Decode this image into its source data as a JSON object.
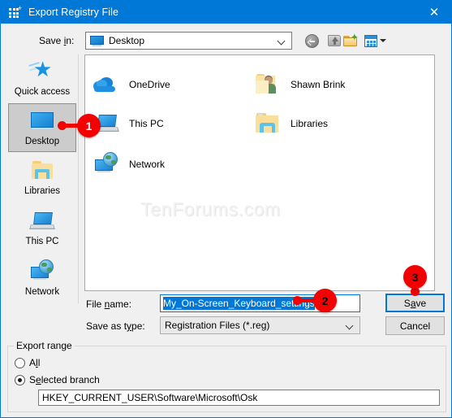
{
  "window": {
    "title": "Export Registry File",
    "icon": "registry-editor-icon",
    "close_label": "✕",
    "accent_color": "#0078d7"
  },
  "savein": {
    "label": "Save in:",
    "label_prefix": "Save ",
    "label_accel": "i",
    "label_suffix": "n:",
    "value": "Desktop",
    "icon": "desktop-monitor-icon"
  },
  "toolbar": {
    "buttons": [
      {
        "name": "back-button",
        "icon": "back-arrow-icon",
        "tooltip": "Back"
      },
      {
        "name": "up-one-level-button",
        "icon": "up-folder-icon",
        "tooltip": "Up One Level"
      },
      {
        "name": "new-folder-button",
        "icon": "new-folder-icon",
        "tooltip": "Create New Folder"
      },
      {
        "name": "views-button",
        "icon": "views-grid-icon",
        "tooltip": "Views"
      }
    ]
  },
  "places": {
    "items": [
      {
        "label": "Quick access",
        "icon": "quick-access-star-icon",
        "selected": false
      },
      {
        "label": "Desktop",
        "icon": "desktop-monitor-icon",
        "selected": true
      },
      {
        "label": "Libraries",
        "icon": "libraries-folder-icon",
        "selected": false
      },
      {
        "label": "This PC",
        "icon": "this-pc-laptop-icon",
        "selected": false
      },
      {
        "label": "Network",
        "icon": "network-globe-icon",
        "selected": false
      }
    ]
  },
  "filelist": {
    "watermark": "TenForums.com",
    "items": [
      {
        "name": "OneDrive",
        "icon": "onedrive-cloud-icon",
        "column": 0,
        "row": 0
      },
      {
        "name": "This PC",
        "icon": "this-pc-laptop-icon",
        "column": 0,
        "row": 1
      },
      {
        "name": "Network",
        "icon": "network-globe-icon",
        "column": 0,
        "row": 2
      },
      {
        "name": "Shawn Brink",
        "icon": "user-folder-icon",
        "column": 1,
        "row": 0
      },
      {
        "name": "Libraries",
        "icon": "libraries-folder-icon",
        "column": 1,
        "row": 1
      }
    ]
  },
  "form": {
    "filename_label_prefix": "File ",
    "filename_label_accel": "n",
    "filename_label_suffix": "ame:",
    "filename_label": "File name:",
    "filename_value": "My_On-Screen_Keyboard_settings",
    "filename_selected": true,
    "filetype_label_prefix": "Save as t",
    "filetype_label_accel": "y",
    "filetype_label_suffix": "pe:",
    "filetype_label": "Save as type:",
    "filetype_value": "Registration Files (*.reg)",
    "save_button_prefix": "S",
    "save_button_accel": "a",
    "save_button_suffix": "ve",
    "save_button": "Save",
    "cancel_button": "Cancel"
  },
  "export_range": {
    "group_title": "Export range",
    "options": [
      {
        "label": "All",
        "label_prefix": "A",
        "label_accel": "l",
        "label_suffix": "l",
        "selected": false
      },
      {
        "label": "Selected branch",
        "label_prefix": "S",
        "label_accel": "e",
        "label_suffix": "lected branch",
        "selected": true
      }
    ],
    "branch_path": "HKEY_CURRENT_USER\\Software\\Microsoft\\Osk"
  },
  "callouts": [
    {
      "number": "1",
      "target": "places-desktop",
      "text_color": "#ffffff"
    },
    {
      "number": "2",
      "target": "filename-input",
      "text_color": "#000000"
    },
    {
      "number": "3",
      "target": "save-button",
      "text_color": "#000000"
    }
  ]
}
